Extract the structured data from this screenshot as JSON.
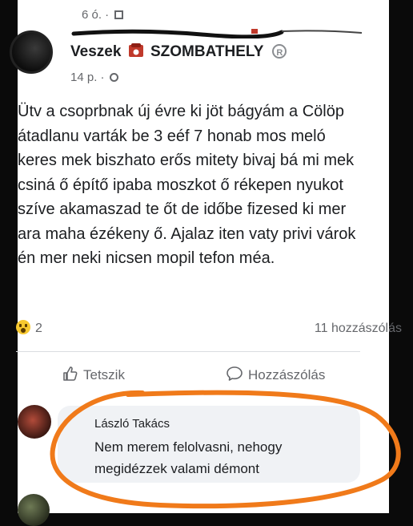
{
  "header": {
    "top_time": "6 ó. ·"
  },
  "post": {
    "author": "Veszek",
    "author_location": "SZOMBATHELY",
    "time": "14 p. ·",
    "text": "Ütv a csoprbnak új évre ki jöt bágyám a Cölöp átadlanu varták be 3 eéf 7 honab mos meló keres mek biszhato erős mitety bivaj bá mi mek csiná ő építő ipaba moszkot ő rékepen nyukot szíve akamaszad te őt de időbe fizesed ki mer ara maha ézékeny ő. Ajalaz iten vaty privi várok én mer neki nicsen mopil tefon méa.",
    "reaction_count": "2",
    "comments_count": "11 hozzászólás"
  },
  "actions": {
    "like_label": "Tetszik",
    "comment_label": "Hozzászólás"
  },
  "comment": {
    "author": "László Takács",
    "text": "Nem merem felolvasni, nehogy megidézzek valami démont"
  },
  "colors": {
    "highlight": "#f07a1a",
    "text": "#1c1e21",
    "muted": "#65676b"
  },
  "icons": [
    "grid-icon",
    "phone-icon",
    "registered-icon",
    "globe-icon",
    "wow-emoji-icon",
    "like-icon",
    "comment-icon"
  ]
}
